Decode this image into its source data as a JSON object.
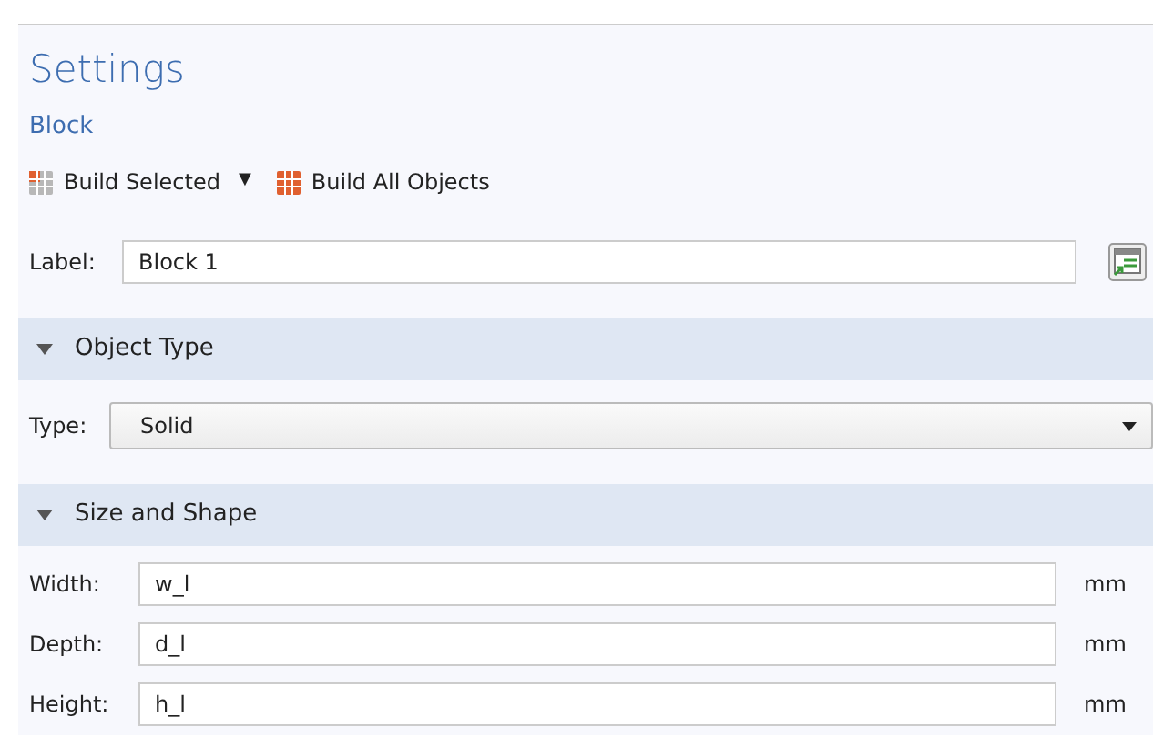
{
  "title": "Settings",
  "subtitle": "Block",
  "toolbar": [
    {
      "kind": "dropdown",
      "label": "Build Selected",
      "caret": "▼"
    },
    {
      "kind": "button",
      "label": "Build All Objects"
    }
  ],
  "label_field": {
    "label": "Label:",
    "value": "Block 1"
  },
  "sections": [
    {
      "title": "Object Type",
      "expanded": true,
      "fields": [
        {
          "kind": "select",
          "label": "Type:",
          "value": "Solid"
        }
      ]
    },
    {
      "title": "Size and Shape",
      "expanded": true,
      "fields": [
        {
          "kind": "input",
          "label": "Width:",
          "value": "w_l",
          "unit": "mm"
        },
        {
          "kind": "input",
          "label": "Depth:",
          "value": "d_l",
          "unit": "mm"
        },
        {
          "kind": "input",
          "label": "Height:",
          "value": "h_l",
          "unit": "mm"
        }
      ]
    }
  ]
}
